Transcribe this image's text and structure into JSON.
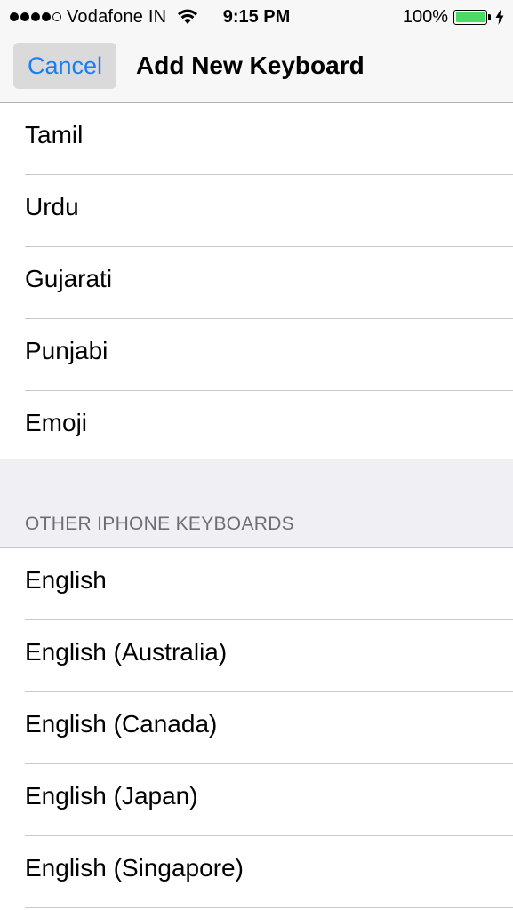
{
  "status_bar": {
    "carrier": "Vodafone IN",
    "time": "9:15 PM",
    "battery_percent": "100%",
    "signal_bars_filled": 4,
    "signal_bars_total": 5,
    "battery_fill_color": "#4cd964"
  },
  "nav": {
    "cancel_label": "Cancel",
    "title": "Add New Keyboard",
    "accent_color": "#1a7ef2"
  },
  "keyboards_top": [
    {
      "label": "Tamil"
    },
    {
      "label": "Urdu"
    },
    {
      "label": "Gujarati"
    },
    {
      "label": "Punjabi"
    },
    {
      "label": "Emoji"
    }
  ],
  "other_section": {
    "header": "OTHER IPHONE KEYBOARDS",
    "items": [
      {
        "label": "English"
      },
      {
        "label": "English (Australia)"
      },
      {
        "label": "English (Canada)"
      },
      {
        "label": "English (Japan)"
      },
      {
        "label": "English (Singapore)"
      }
    ]
  }
}
